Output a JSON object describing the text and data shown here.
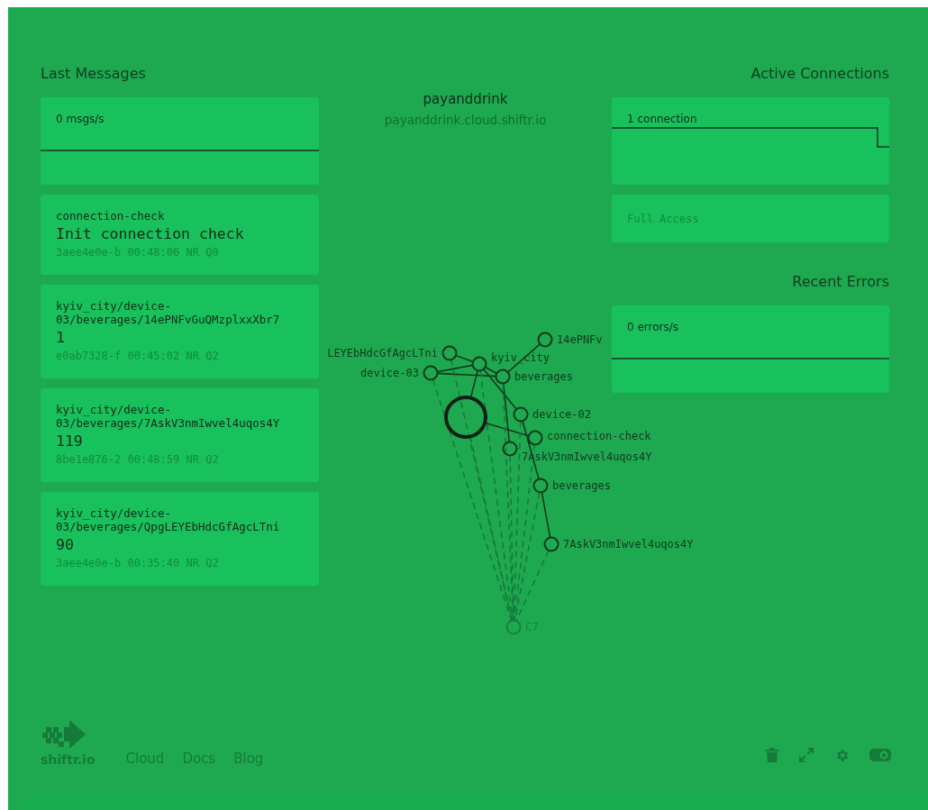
{
  "header": {
    "title": "payanddrink",
    "host": "payanddrink.cloud.shiftr.io"
  },
  "messages_panel": {
    "title": "Last Messages",
    "rate": "0 msgs/s",
    "messages": [
      {
        "topic": "connection-check",
        "payload": "Init connection check",
        "meta": "3aee4e0e-b 00:48:06 NR Q0"
      },
      {
        "topic": "kyiv_city/device-03/beverages/14ePNFvGuQMzplxxXbr7",
        "payload": "1",
        "meta": "e0ab7328-f 00:45:02 NR Q2"
      },
      {
        "topic": "kyiv_city/device-03/beverages/7AskV3nmIwvel4uqos4Y",
        "payload": "119",
        "meta": "8be1e876-2 00:48:59 NR Q2"
      },
      {
        "topic": "kyiv_city/device-03/beverages/QpgLEYEbHdcGfAgcLTni",
        "payload": "90",
        "meta": "3aee4e0e-b 00:35:40 NR Q2"
      }
    ]
  },
  "connections_panel": {
    "title": "Active Connections",
    "count": "1 connection",
    "access": "Full Access"
  },
  "errors_panel": {
    "title": "Recent Errors",
    "rate": "0 errors/s"
  },
  "graph": {
    "nodes": [
      {
        "kind": "broker"
      },
      {
        "kind": "topic",
        "label": "LEYEbHdcGfAgcLTni"
      },
      {
        "kind": "topic",
        "label": "device-03"
      },
      {
        "kind": "topic",
        "label": "kyiv_city"
      },
      {
        "kind": "topic",
        "label": "beverages"
      },
      {
        "kind": "topic",
        "label": "14ePNFv"
      },
      {
        "kind": "topic",
        "label": "device-02"
      },
      {
        "kind": "topic",
        "label": "connection-check"
      },
      {
        "kind": "topic",
        "label": "7AskV3nmIwvel4uqos4Y"
      },
      {
        "kind": "topic",
        "label": "beverages"
      },
      {
        "kind": "topic",
        "label": "7AskV3nmIwvel4uqos4Y"
      },
      {
        "kind": "client",
        "label": "C7"
      }
    ]
  },
  "footer": {
    "logo": "shiftr.io",
    "links": [
      "Cloud",
      "Docs",
      "Blog"
    ],
    "toggle": {
      "on": true
    }
  }
}
